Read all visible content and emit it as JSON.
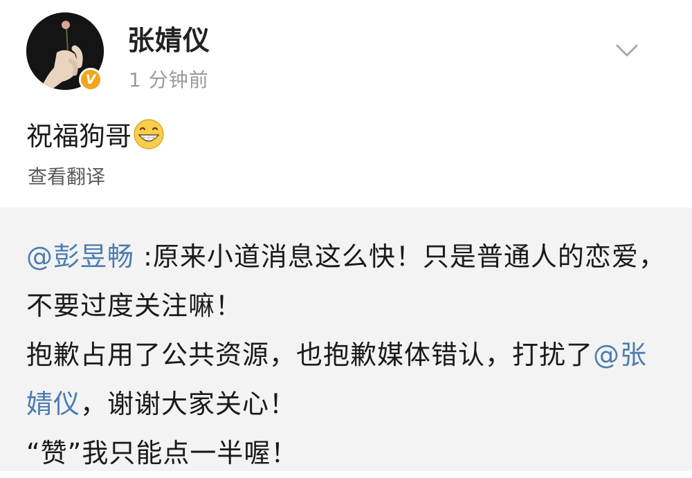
{
  "post": {
    "author": "张婧仪",
    "time": "1 分钟前",
    "verified_badge": "V",
    "badge_color": "#f3a51c",
    "text": "祝福狗哥",
    "emoji": "grinning-face-emoji",
    "translate_label": "查看翻译",
    "menu_icon": "chevron-down-icon"
  },
  "repost": {
    "mention1": "@彭昱畅",
    "colon": " :",
    "text1": "原来小道消息这么快！只是普通人的恋爱，不要过度关注嘛！",
    "text2": "抱歉占用了公共资源，也抱歉媒体错认，打扰了",
    "mention2": "@张婧仪",
    "text3": "，谢谢大家关心！",
    "text4": "“赞”我只能点一半喔！",
    "mention_color": "#4b7cb0"
  }
}
